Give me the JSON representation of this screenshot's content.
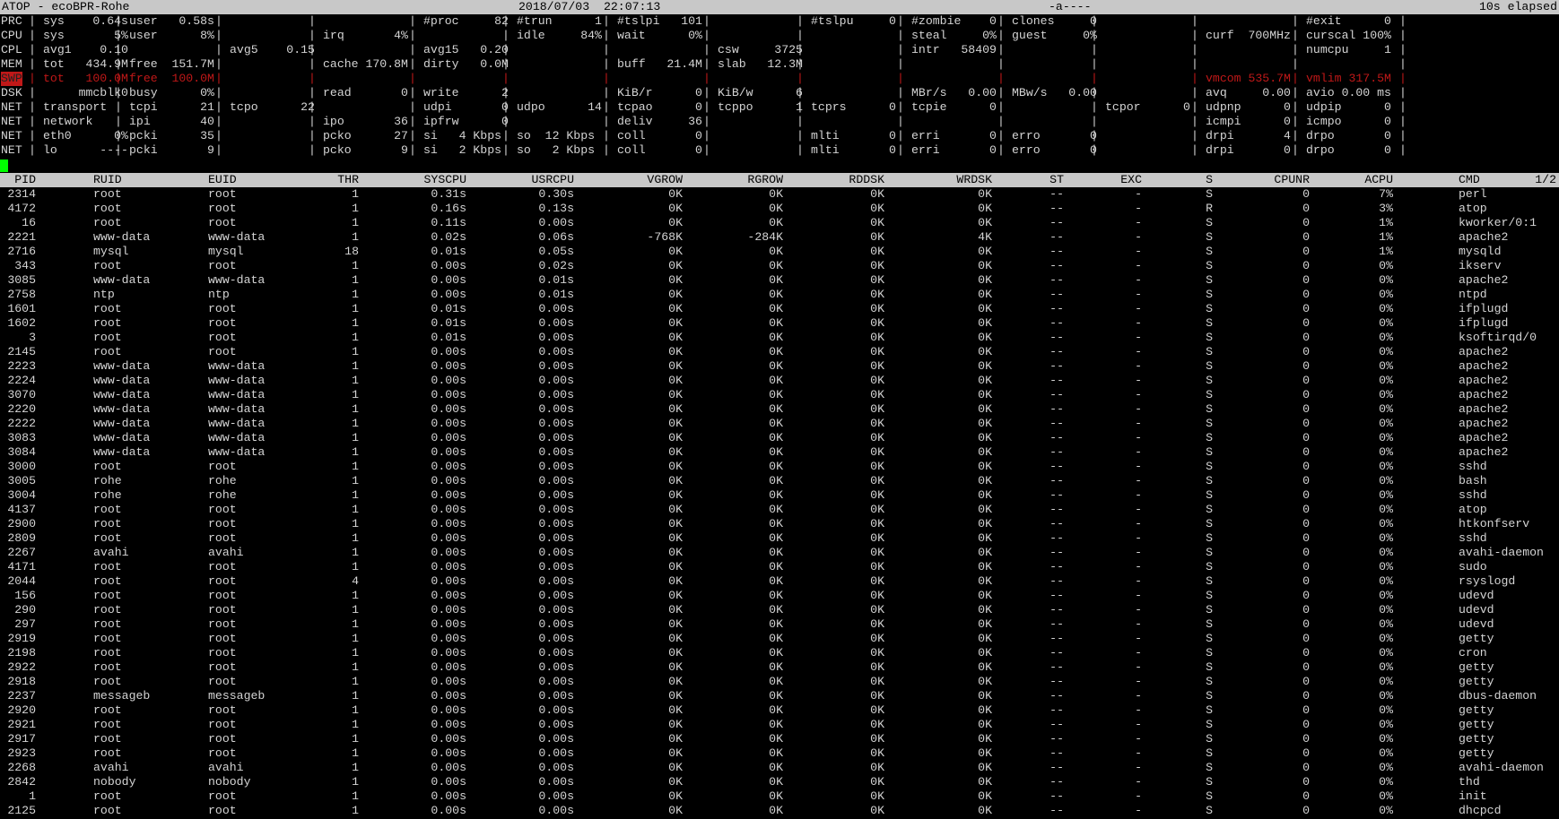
{
  "header": {
    "title": "ATOP - ecoBPR-Rohe",
    "datetime": "2018/07/03  22:07:13",
    "flags": "-a----",
    "elapsed": "10s elapsed"
  },
  "system_lines": [
    {
      "label": "PRC",
      "red": false,
      "cells": [
        "sys    0.64s",
        "user   0.58s",
        "",
        "",
        "#proc     82",
        "#trun      1",
        "#tslpi   101",
        "",
        "#tslpu     0",
        "#zombie    0",
        "clones     0",
        "",
        "",
        "#exit      0"
      ]
    },
    {
      "label": "CPU",
      "red": false,
      "cells": [
        "sys       5%",
        "user      8%",
        "",
        "irq       4%",
        "",
        "idle     84%",
        "wait      0%",
        "",
        "",
        "steal     0%",
        "guest     0%",
        "",
        "curf  700MHz",
        "curscal 100%"
      ]
    },
    {
      "label": "CPL",
      "red": false,
      "cells": [
        "avg1    0.10",
        "",
        "avg5    0.15",
        "",
        "avg15   0.20",
        "",
        "",
        "csw     3725",
        "",
        "intr   58409",
        "",
        "",
        "",
        "numcpu     1"
      ]
    },
    {
      "label": "MEM",
      "red": false,
      "cells": [
        "tot   434.9M",
        "free  151.7M",
        "",
        "cache 170.8M",
        "dirty   0.0M",
        "",
        "buff   21.4M",
        "slab   12.3M",
        "",
        "",
        "",
        "",
        "",
        ""
      ]
    },
    {
      "label": "SWP",
      "red": true,
      "cells": [
        "tot   100.0M",
        "free  100.0M",
        "",
        "",
        "",
        "",
        "",
        "",
        "",
        "",
        "",
        "",
        "vmcom 535.7M",
        "vmlim 317.5M"
      ]
    },
    {
      "label": "DSK",
      "red": false,
      "cells": [
        "     mmcblk0",
        "busy      0%",
        "",
        "read       0",
        "write      2",
        "",
        "KiB/r      0",
        "KiB/w      6",
        "",
        "MBr/s   0.00",
        "MBw/s   0.00",
        "",
        "avq     0.00",
        "avio 0.00 ms"
      ]
    },
    {
      "label": "NET",
      "red": false,
      "cells": [
        "transport   ",
        "tcpi      21",
        "tcpo      22",
        "",
        "udpi       0",
        "udpo      14",
        "tcpao      0",
        "tcppo      1",
        "tcprs      0",
        "tcpie      0",
        "",
        "tcpor      0",
        "udpnp      0",
        "udpip      0"
      ]
    },
    {
      "label": "NET",
      "red": false,
      "cells": [
        "network     ",
        "ipi       40",
        "",
        "ipo       36",
        "ipfrw      0",
        "",
        "deliv     36",
        "",
        "",
        "",
        "",
        "",
        "icmpi      0",
        "icmpo      0"
      ]
    },
    {
      "label": "NET",
      "red": false,
      "cells": [
        "eth0      0%",
        "pcki      35",
        "",
        "pcko      27",
        "si   4 Kbps",
        "so  12 Kbps",
        "coll       0",
        "",
        "mlti       0",
        "erri       0",
        "erro       0",
        "",
        "drpi       4",
        "drpo       0"
      ]
    },
    {
      "label": "NET",
      "red": false,
      "cells": [
        "lo      ----",
        "pcki       9",
        "",
        "pcko       9",
        "si   2 Kbps",
        "so   2 Kbps",
        "coll       0",
        "",
        "mlti       0",
        "erri       0",
        "erro       0",
        "",
        "drpi       0",
        "drpo       0"
      ]
    }
  ],
  "columns": [
    "PID",
    "RUID",
    "EUID",
    "THR",
    "SYSCPU",
    "USRCPU",
    "VGROW",
    "RGROW",
    "RDDSK",
    "WRDSK",
    "ST",
    "EXC",
    "S",
    "CPUNR",
    "ACPU",
    "CMD",
    "1/2"
  ],
  "processes": [
    [
      "2314",
      "root",
      "root",
      "1",
      "0.31s",
      "0.30s",
      "0K",
      "0K",
      "0K",
      "0K",
      "--",
      "-",
      "S",
      "0",
      "7%",
      "perl"
    ],
    [
      "4172",
      "root",
      "root",
      "1",
      "0.16s",
      "0.13s",
      "0K",
      "0K",
      "0K",
      "0K",
      "--",
      "-",
      "R",
      "0",
      "3%",
      "atop"
    ],
    [
      "16",
      "root",
      "root",
      "1",
      "0.11s",
      "0.00s",
      "0K",
      "0K",
      "0K",
      "0K",
      "--",
      "-",
      "S",
      "0",
      "1%",
      "kworker/0:1"
    ],
    [
      "2221",
      "www-data",
      "www-data",
      "1",
      "0.02s",
      "0.06s",
      "-768K",
      "-284K",
      "0K",
      "4K",
      "--",
      "-",
      "S",
      "0",
      "1%",
      "apache2"
    ],
    [
      "2716",
      "mysql",
      "mysql",
      "18",
      "0.01s",
      "0.05s",
      "0K",
      "0K",
      "0K",
      "0K",
      "--",
      "-",
      "S",
      "0",
      "1%",
      "mysqld"
    ],
    [
      "343",
      "root",
      "root",
      "1",
      "0.00s",
      "0.02s",
      "0K",
      "0K",
      "0K",
      "0K",
      "--",
      "-",
      "S",
      "0",
      "0%",
      "ikserv"
    ],
    [
      "3085",
      "www-data",
      "www-data",
      "1",
      "0.00s",
      "0.01s",
      "0K",
      "0K",
      "0K",
      "0K",
      "--",
      "-",
      "S",
      "0",
      "0%",
      "apache2"
    ],
    [
      "2758",
      "ntp",
      "ntp",
      "1",
      "0.00s",
      "0.01s",
      "0K",
      "0K",
      "0K",
      "0K",
      "--",
      "-",
      "S",
      "0",
      "0%",
      "ntpd"
    ],
    [
      "1601",
      "root",
      "root",
      "1",
      "0.01s",
      "0.00s",
      "0K",
      "0K",
      "0K",
      "0K",
      "--",
      "-",
      "S",
      "0",
      "0%",
      "ifplugd"
    ],
    [
      "1602",
      "root",
      "root",
      "1",
      "0.01s",
      "0.00s",
      "0K",
      "0K",
      "0K",
      "0K",
      "--",
      "-",
      "S",
      "0",
      "0%",
      "ifplugd"
    ],
    [
      "3",
      "root",
      "root",
      "1",
      "0.01s",
      "0.00s",
      "0K",
      "0K",
      "0K",
      "0K",
      "--",
      "-",
      "S",
      "0",
      "0%",
      "ksoftirqd/0"
    ],
    [
      "2145",
      "root",
      "root",
      "1",
      "0.00s",
      "0.00s",
      "0K",
      "0K",
      "0K",
      "0K",
      "--",
      "-",
      "S",
      "0",
      "0%",
      "apache2"
    ],
    [
      "2223",
      "www-data",
      "www-data",
      "1",
      "0.00s",
      "0.00s",
      "0K",
      "0K",
      "0K",
      "0K",
      "--",
      "-",
      "S",
      "0",
      "0%",
      "apache2"
    ],
    [
      "2224",
      "www-data",
      "www-data",
      "1",
      "0.00s",
      "0.00s",
      "0K",
      "0K",
      "0K",
      "0K",
      "--",
      "-",
      "S",
      "0",
      "0%",
      "apache2"
    ],
    [
      "3070",
      "www-data",
      "www-data",
      "1",
      "0.00s",
      "0.00s",
      "0K",
      "0K",
      "0K",
      "0K",
      "--",
      "-",
      "S",
      "0",
      "0%",
      "apache2"
    ],
    [
      "2220",
      "www-data",
      "www-data",
      "1",
      "0.00s",
      "0.00s",
      "0K",
      "0K",
      "0K",
      "0K",
      "--",
      "-",
      "S",
      "0",
      "0%",
      "apache2"
    ],
    [
      "2222",
      "www-data",
      "www-data",
      "1",
      "0.00s",
      "0.00s",
      "0K",
      "0K",
      "0K",
      "0K",
      "--",
      "-",
      "S",
      "0",
      "0%",
      "apache2"
    ],
    [
      "3083",
      "www-data",
      "www-data",
      "1",
      "0.00s",
      "0.00s",
      "0K",
      "0K",
      "0K",
      "0K",
      "--",
      "-",
      "S",
      "0",
      "0%",
      "apache2"
    ],
    [
      "3084",
      "www-data",
      "www-data",
      "1",
      "0.00s",
      "0.00s",
      "0K",
      "0K",
      "0K",
      "0K",
      "--",
      "-",
      "S",
      "0",
      "0%",
      "apache2"
    ],
    [
      "3000",
      "root",
      "root",
      "1",
      "0.00s",
      "0.00s",
      "0K",
      "0K",
      "0K",
      "0K",
      "--",
      "-",
      "S",
      "0",
      "0%",
      "sshd"
    ],
    [
      "3005",
      "rohe",
      "rohe",
      "1",
      "0.00s",
      "0.00s",
      "0K",
      "0K",
      "0K",
      "0K",
      "--",
      "-",
      "S",
      "0",
      "0%",
      "bash"
    ],
    [
      "3004",
      "rohe",
      "rohe",
      "1",
      "0.00s",
      "0.00s",
      "0K",
      "0K",
      "0K",
      "0K",
      "--",
      "-",
      "S",
      "0",
      "0%",
      "sshd"
    ],
    [
      "4137",
      "root",
      "root",
      "1",
      "0.00s",
      "0.00s",
      "0K",
      "0K",
      "0K",
      "0K",
      "--",
      "-",
      "S",
      "0",
      "0%",
      "atop"
    ],
    [
      "2900",
      "root",
      "root",
      "1",
      "0.00s",
      "0.00s",
      "0K",
      "0K",
      "0K",
      "0K",
      "--",
      "-",
      "S",
      "0",
      "0%",
      "htkonfserv"
    ],
    [
      "2809",
      "root",
      "root",
      "1",
      "0.00s",
      "0.00s",
      "0K",
      "0K",
      "0K",
      "0K",
      "--",
      "-",
      "S",
      "0",
      "0%",
      "sshd"
    ],
    [
      "2267",
      "avahi",
      "avahi",
      "1",
      "0.00s",
      "0.00s",
      "0K",
      "0K",
      "0K",
      "0K",
      "--",
      "-",
      "S",
      "0",
      "0%",
      "avahi-daemon"
    ],
    [
      "4171",
      "root",
      "root",
      "1",
      "0.00s",
      "0.00s",
      "0K",
      "0K",
      "0K",
      "0K",
      "--",
      "-",
      "S",
      "0",
      "0%",
      "sudo"
    ],
    [
      "2044",
      "root",
      "root",
      "4",
      "0.00s",
      "0.00s",
      "0K",
      "0K",
      "0K",
      "0K",
      "--",
      "-",
      "S",
      "0",
      "0%",
      "rsyslogd"
    ],
    [
      "156",
      "root",
      "root",
      "1",
      "0.00s",
      "0.00s",
      "0K",
      "0K",
      "0K",
      "0K",
      "--",
      "-",
      "S",
      "0",
      "0%",
      "udevd"
    ],
    [
      "290",
      "root",
      "root",
      "1",
      "0.00s",
      "0.00s",
      "0K",
      "0K",
      "0K",
      "0K",
      "--",
      "-",
      "S",
      "0",
      "0%",
      "udevd"
    ],
    [
      "297",
      "root",
      "root",
      "1",
      "0.00s",
      "0.00s",
      "0K",
      "0K",
      "0K",
      "0K",
      "--",
      "-",
      "S",
      "0",
      "0%",
      "udevd"
    ],
    [
      "2919",
      "root",
      "root",
      "1",
      "0.00s",
      "0.00s",
      "0K",
      "0K",
      "0K",
      "0K",
      "--",
      "-",
      "S",
      "0",
      "0%",
      "getty"
    ],
    [
      "2198",
      "root",
      "root",
      "1",
      "0.00s",
      "0.00s",
      "0K",
      "0K",
      "0K",
      "0K",
      "--",
      "-",
      "S",
      "0",
      "0%",
      "cron"
    ],
    [
      "2922",
      "root",
      "root",
      "1",
      "0.00s",
      "0.00s",
      "0K",
      "0K",
      "0K",
      "0K",
      "--",
      "-",
      "S",
      "0",
      "0%",
      "getty"
    ],
    [
      "2918",
      "root",
      "root",
      "1",
      "0.00s",
      "0.00s",
      "0K",
      "0K",
      "0K",
      "0K",
      "--",
      "-",
      "S",
      "0",
      "0%",
      "getty"
    ],
    [
      "2237",
      "messageb",
      "messageb",
      "1",
      "0.00s",
      "0.00s",
      "0K",
      "0K",
      "0K",
      "0K",
      "--",
      "-",
      "S",
      "0",
      "0%",
      "dbus-daemon"
    ],
    [
      "2920",
      "root",
      "root",
      "1",
      "0.00s",
      "0.00s",
      "0K",
      "0K",
      "0K",
      "0K",
      "--",
      "-",
      "S",
      "0",
      "0%",
      "getty"
    ],
    [
      "2921",
      "root",
      "root",
      "1",
      "0.00s",
      "0.00s",
      "0K",
      "0K",
      "0K",
      "0K",
      "--",
      "-",
      "S",
      "0",
      "0%",
      "getty"
    ],
    [
      "2917",
      "root",
      "root",
      "1",
      "0.00s",
      "0.00s",
      "0K",
      "0K",
      "0K",
      "0K",
      "--",
      "-",
      "S",
      "0",
      "0%",
      "getty"
    ],
    [
      "2923",
      "root",
      "root",
      "1",
      "0.00s",
      "0.00s",
      "0K",
      "0K",
      "0K",
      "0K",
      "--",
      "-",
      "S",
      "0",
      "0%",
      "getty"
    ],
    [
      "2268",
      "avahi",
      "avahi",
      "1",
      "0.00s",
      "0.00s",
      "0K",
      "0K",
      "0K",
      "0K",
      "--",
      "-",
      "S",
      "0",
      "0%",
      "avahi-daemon"
    ],
    [
      "2842",
      "nobody",
      "nobody",
      "1",
      "0.00s",
      "0.00s",
      "0K",
      "0K",
      "0K",
      "0K",
      "--",
      "-",
      "S",
      "0",
      "0%",
      "thd"
    ],
    [
      "1",
      "root",
      "root",
      "1",
      "0.00s",
      "0.00s",
      "0K",
      "0K",
      "0K",
      "0K",
      "--",
      "-",
      "S",
      "0",
      "0%",
      "init"
    ],
    [
      "2125",
      "root",
      "root",
      "1",
      "0.00s",
      "0.00s",
      "0K",
      "0K",
      "0K",
      "0K",
      "--",
      "-",
      "S",
      "0",
      "0%",
      "dhcpcd"
    ]
  ],
  "colors": {
    "background": "#000000",
    "text": "#d4d4d4",
    "header_bar": "#c8c8c8",
    "alert_red": "#c01818",
    "cursor": "#00ff00"
  }
}
